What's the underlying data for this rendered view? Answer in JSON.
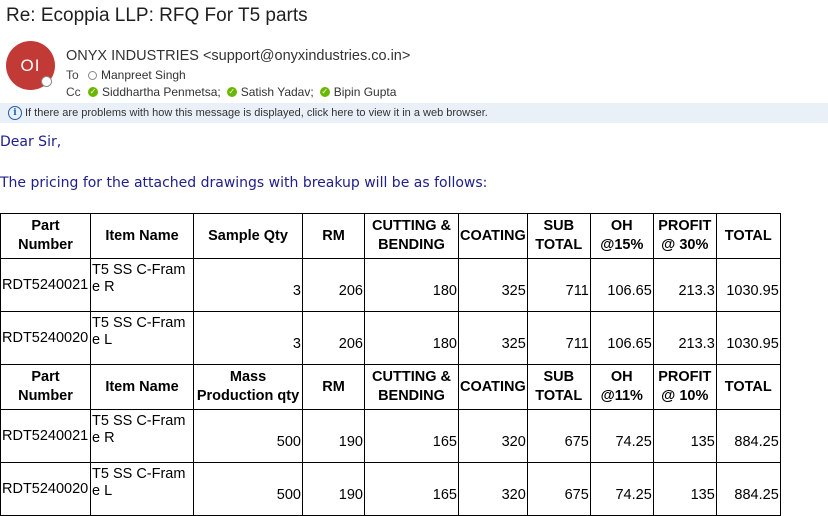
{
  "email": {
    "subject": "Re: Ecoppia LLP: RFQ For T5 parts",
    "avatar_initials": "OI",
    "sender": "ONYX INDUSTRIES <support@onyxindustries.co.in>",
    "to_label": "To",
    "to": [
      {
        "name": "Manpreet Singh",
        "status": "offline"
      }
    ],
    "cc_label": "Cc",
    "cc": [
      {
        "name": "Siddhartha Penmetsa;",
        "status": "available"
      },
      {
        "name": "Satish  Yadav;",
        "status": "available"
      },
      {
        "name": "Bipin Gupta",
        "status": "available"
      }
    ],
    "info_bar": "If there are problems with how this message is displayed, click here to view it in a web browser.",
    "greeting": "Dear Sir,",
    "intro": "The pricing for the attached drawings with breakup will be as follows:"
  },
  "table": {
    "sections": [
      {
        "headers": [
          "Part Number",
          "Item Name",
          "Sample Qty",
          "RM",
          "CUTTING & BENDING",
          "COATING",
          "SUB TOTAL",
          "OH @15%",
          "PROFIT @ 30%",
          "TOTAL"
        ],
        "rows": [
          [
            "RDT5240021",
            "T5 SS C-Frame R",
            "3",
            "206",
            "180",
            "325",
            "711",
            "106.65",
            "213.3",
            "1030.95"
          ],
          [
            "RDT5240020",
            "T5 SS C-Frame L",
            "3",
            "206",
            "180",
            "325",
            "711",
            "106.65",
            "213.3",
            "1030.95"
          ]
        ]
      },
      {
        "headers": [
          "Part Number",
          "Item Name",
          "Mass Production qty",
          "RM",
          "CUTTING & BENDING",
          "COATING",
          "SUB TOTAL",
          "OH @11%",
          "PROFIT @ 10%",
          "TOTAL"
        ],
        "rows": [
          [
            "RDT5240021",
            "T5 SS C-Frame R",
            "500",
            "190",
            "165",
            "320",
            "675",
            "74.25",
            "135",
            "884.25"
          ],
          [
            "RDT5240020",
            "T5 SS C-Frame L",
            "500",
            "190",
            "165",
            "320",
            "675",
            "74.25",
            "135",
            "884.25"
          ]
        ]
      }
    ]
  },
  "colors": {
    "avatar_bg": "#c23a35",
    "body_text": "#20208a",
    "info_bar_bg": "#e9f0f8",
    "available_status": "#6bb700"
  }
}
